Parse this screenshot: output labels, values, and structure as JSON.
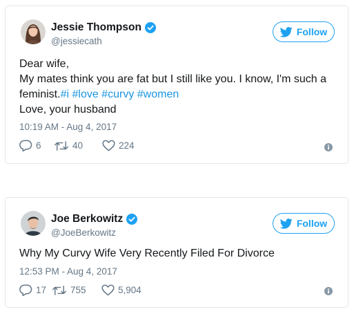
{
  "tweets": [
    {
      "user": {
        "display_name": "Jessie Thompson",
        "handle": "@jessiecath",
        "verified": true,
        "avatar_icon": "female-profile-photo"
      },
      "follow_label": "Follow",
      "text": {
        "line1": "Dear wife,",
        "line2": "My mates think you are fat but I still like you. I know, I'm such a",
        "line3_prefix": "feminist.",
        "hashtags": [
          "#i",
          "#love",
          "#curvy",
          "#women"
        ],
        "line4": "Love, your husband"
      },
      "timestamp": "10:19 AM - Aug 4, 2017",
      "stats": {
        "replies": "6",
        "retweets": "40",
        "likes": "224"
      }
    },
    {
      "user": {
        "display_name": "Joe Berkowitz",
        "handle": "@JoeBerkowitz",
        "verified": true,
        "avatar_icon": "male-profile-photo"
      },
      "follow_label": "Follow",
      "text": {
        "line1": "Why My Curvy Wife Very Recently Filed For Divorce"
      },
      "timestamp": "12:53 PM - Aug 4, 2017",
      "stats": {
        "replies": "17",
        "retweets": "755",
        "likes": "5,904"
      }
    }
  ],
  "colors": {
    "accent": "#1da1f2",
    "hashtag": "#1b95e0",
    "muted": "#657786",
    "border": "#e1e8ed"
  }
}
